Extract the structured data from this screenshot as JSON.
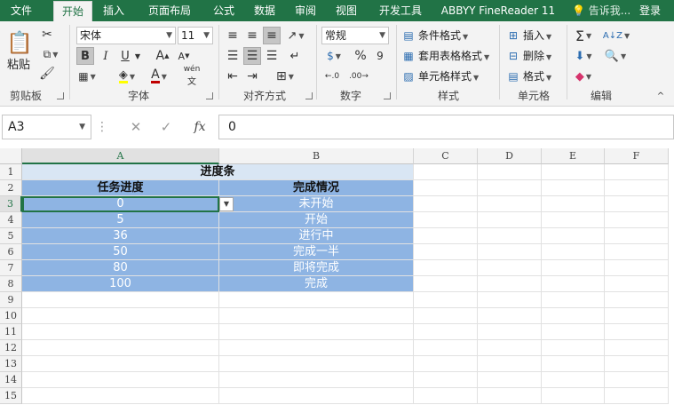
{
  "tabs": [
    "文件",
    "开始",
    "插入",
    "页面布局",
    "公式",
    "数据",
    "审阅",
    "视图",
    "开发工具",
    "ABBYY FineReader 11"
  ],
  "active_tab": "开始",
  "tell_me": "告诉我...",
  "login": "登录",
  "ribbon": {
    "clipboard": {
      "paste": "粘贴",
      "label": "剪贴板"
    },
    "font": {
      "name": "宋体",
      "size": "11",
      "bold": "B",
      "italic": "I",
      "underline": "U",
      "grow": "A",
      "shrink": "A",
      "phonetic": "wén",
      "color_a": "A",
      "label": "字体"
    },
    "alignment": {
      "label": "对齐方式"
    },
    "number": {
      "format": "常规",
      "percent": "%",
      "comma": "9",
      "label": "数字"
    },
    "styles": {
      "conditional": "条件格式",
      "table": "套用表格格式",
      "cell": "单元格样式",
      "label": "样式"
    },
    "cells": {
      "insert": "插入",
      "delete": "删除",
      "format": "格式",
      "label": "单元格"
    },
    "editing": {
      "label": "编辑"
    }
  },
  "formula_bar": {
    "name_box": "A3",
    "cancel": "✕",
    "enter": "✓",
    "fx": "fx",
    "value": "0"
  },
  "columns": [
    "A",
    "B",
    "C",
    "D",
    "E",
    "F"
  ],
  "rows": [
    "1",
    "2",
    "3",
    "4",
    "5",
    "6",
    "7",
    "8",
    "9",
    "10",
    "11",
    "12",
    "13",
    "14",
    "15"
  ],
  "sheet": {
    "title": "进度条",
    "headers": [
      "任务进度",
      "完成情况"
    ],
    "data": [
      [
        "0",
        "未开始"
      ],
      [
        "5",
        "开始"
      ],
      [
        "36",
        "进行中"
      ],
      [
        "50",
        "完成一半"
      ],
      [
        "80",
        "即将完成"
      ],
      [
        "100",
        "完成"
      ]
    ]
  },
  "colors": {
    "brand": "#217346",
    "header_fill": "#d9e6f4",
    "data_fill": "#8eb4e3"
  }
}
